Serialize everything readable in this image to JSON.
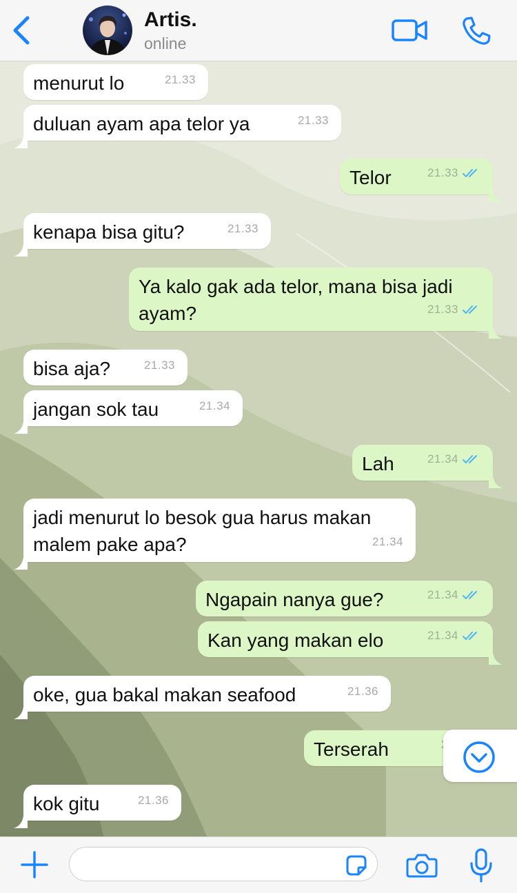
{
  "header": {
    "back_icon": "chevron-left-icon",
    "contact_name": "Artis.",
    "status": "online",
    "video_icon": "video-camera-icon",
    "call_icon": "phone-icon"
  },
  "messages": [
    {
      "dir": "in",
      "text": "menurut lo",
      "time": "21.33"
    },
    {
      "dir": "in",
      "text": "duluan ayam apa telor ya",
      "time": "21.33"
    },
    {
      "dir": "out",
      "text": "Telor",
      "time": "21.33",
      "read": true
    },
    {
      "dir": "in",
      "text": "kenapa bisa gitu?",
      "time": "21.33"
    },
    {
      "dir": "out",
      "text": "Ya kalo gak ada telor, mana bisa jadi ayam?",
      "time": "21.33",
      "read": true
    },
    {
      "dir": "in",
      "text": "bisa aja?",
      "time": "21.33"
    },
    {
      "dir": "in",
      "text": "jangan sok tau",
      "time": "21.34"
    },
    {
      "dir": "out",
      "text": "Lah",
      "time": "21.34",
      "read": true
    },
    {
      "dir": "in",
      "text": "jadi menurut lo besok gua harus makan malem pake apa?",
      "time": "21.34"
    },
    {
      "dir": "out",
      "text": "Ngapain nanya gue?",
      "time": "21.34",
      "read": true
    },
    {
      "dir": "out",
      "text": "Kan yang makan elo",
      "time": "21.34",
      "read": true
    },
    {
      "dir": "in",
      "text": "oke, gua bakal makan seafood",
      "time": "21.36"
    },
    {
      "dir": "out",
      "text": "Terserah",
      "time": "21.",
      "read": true
    },
    {
      "dir": "in",
      "text": "kok gitu",
      "time": "21.36"
    }
  ],
  "scroll_down_icon": "chevron-down-circle-icon",
  "composer": {
    "attach_icon": "plus-icon",
    "input_value": "",
    "sticker_icon": "sticker-icon",
    "camera_icon": "camera-icon",
    "mic_icon": "microphone-icon"
  },
  "colors": {
    "accent": "#1a84ff",
    "outgoing_bubble": "#dcf7c5",
    "incoming_bubble": "#ffffff",
    "read_tick": "#4fb4f5",
    "wallpaper": "#dfe3d2"
  }
}
